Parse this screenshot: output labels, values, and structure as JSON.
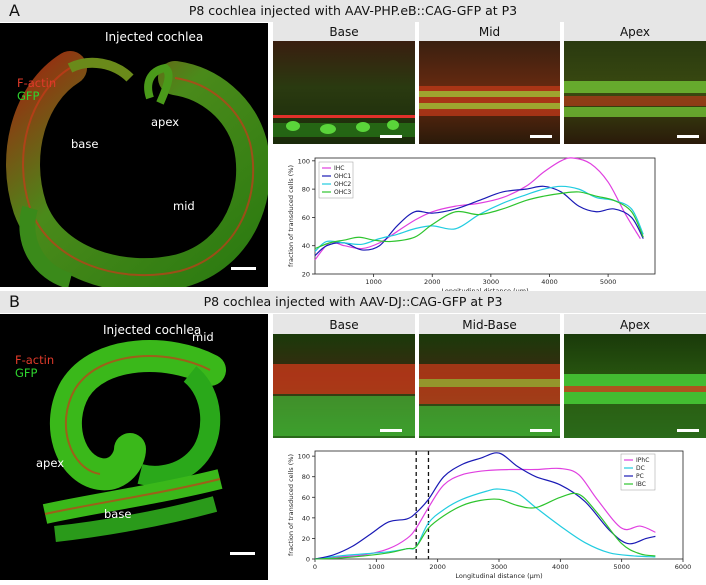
{
  "panel_a": {
    "letter": "A",
    "title": "P8 cochlea injected with AAV-PHP.eB::CAG-GFP at P3",
    "micrograph": {
      "heading": "Injected cochlea",
      "legend_red": "F-actin",
      "legend_green": "GFP",
      "labels": [
        "apex",
        "base",
        "mid"
      ]
    },
    "tiles": [
      "Base",
      "Mid",
      "Apex"
    ]
  },
  "panel_b": {
    "letter": "B",
    "title": "P8 cochlea injected with AAV-DJ::CAG-GFP at P3",
    "micrograph": {
      "heading": "Injected cochlea",
      "legend_red": "F-actin",
      "legend_green": "GFP",
      "labels": [
        "mid",
        "apex",
        "base"
      ]
    },
    "tiles": [
      "Base",
      "Mid-Base",
      "Apex"
    ]
  },
  "colors": {
    "magenta": "#e040e0",
    "blue": "#1a1ab5",
    "cyan": "#22cce0",
    "green": "#2ec42e"
  },
  "chart_data": [
    {
      "type": "line",
      "xlabel": "Longitudinal distance (µm)",
      "ylabel": "fraction of transduced cells (%)",
      "xlim": [
        0,
        5800
      ],
      "ylim": [
        20,
        102
      ],
      "xticks": [
        1000,
        2000,
        3000,
        4000,
        5000
      ],
      "yticks": [
        20,
        40,
        60,
        80,
        100
      ],
      "legend_position": "top-left",
      "series": [
        {
          "name": "IHC",
          "color": "#e040e0",
          "x": [
            0,
            250,
            500,
            800,
            1100,
            1400,
            1700,
            2000,
            2400,
            2800,
            3200,
            3600,
            3900,
            4200,
            4400,
            4700,
            5000,
            5300,
            5550
          ],
          "y": [
            30,
            42,
            40,
            38,
            42,
            50,
            58,
            64,
            68,
            70,
            74,
            82,
            92,
            100,
            102,
            98,
            85,
            62,
            45
          ]
        },
        {
          "name": "OHC1",
          "color": "#1a1ab5",
          "x": [
            0,
            200,
            500,
            800,
            1100,
            1400,
            1700,
            2000,
            2400,
            2800,
            3200,
            3600,
            3900,
            4200,
            4500,
            4800,
            5100,
            5400,
            5600
          ],
          "y": [
            33,
            40,
            42,
            37,
            40,
            54,
            64,
            63,
            66,
            72,
            78,
            80,
            82,
            78,
            68,
            64,
            66,
            60,
            45
          ]
        },
        {
          "name": "OHC2",
          "color": "#22cce0",
          "x": [
            0,
            200,
            500,
            800,
            1100,
            1400,
            1700,
            2000,
            2400,
            2800,
            3200,
            3600,
            3900,
            4200,
            4500,
            4800,
            5100,
            5400,
            5600
          ],
          "y": [
            36,
            43,
            42,
            41,
            45,
            48,
            52,
            54,
            52,
            62,
            70,
            76,
            80,
            82,
            80,
            74,
            72,
            66,
            48
          ]
        },
        {
          "name": "OHC3",
          "color": "#2ec42e",
          "x": [
            0,
            250,
            500,
            750,
            1000,
            1300,
            1700,
            2000,
            2400,
            2800,
            3200,
            3600,
            3900,
            4200,
            4500,
            4800,
            5100,
            5400,
            5600
          ],
          "y": [
            38,
            42,
            44,
            46,
            44,
            43,
            46,
            55,
            64,
            62,
            66,
            72,
            75,
            77,
            78,
            75,
            72,
            64,
            46
          ]
        }
      ]
    },
    {
      "type": "line",
      "xlabel": "Longitudinal distance (µm)",
      "ylabel": "fraction of transduced cells (%)",
      "xlim": [
        0,
        6000
      ],
      "ylim": [
        0,
        105
      ],
      "xticks": [
        0,
        1000,
        2000,
        3000,
        4000,
        5000,
        6000
      ],
      "yticks": [
        0,
        20,
        40,
        60,
        80,
        100
      ],
      "legend_position": "top-right",
      "dashed_vlines": [
        1650,
        1850
      ],
      "series": [
        {
          "name": "IPhC",
          "color": "#e040e0",
          "x": [
            0,
            400,
            800,
            1200,
            1500,
            1650,
            1850,
            2100,
            2400,
            2800,
            3200,
            3600,
            4000,
            4300,
            4600,
            5000,
            5300,
            5550
          ],
          "y": [
            0,
            2,
            4,
            10,
            20,
            30,
            50,
            72,
            82,
            86,
            87,
            87,
            88,
            82,
            58,
            30,
            32,
            26
          ]
        },
        {
          "name": "DC",
          "color": "#22cce0",
          "x": [
            0,
            400,
            800,
            1200,
            1500,
            1650,
            1850,
            2100,
            2400,
            2800,
            3000,
            3300,
            3600,
            4000,
            4400,
            4800,
            5200,
            5550
          ],
          "y": [
            0,
            3,
            5,
            7,
            10,
            12,
            35,
            48,
            58,
            66,
            68,
            64,
            50,
            32,
            16,
            6,
            3,
            2
          ]
        },
        {
          "name": "PC",
          "color": "#1a1ab5",
          "x": [
            0,
            300,
            600,
            900,
            1200,
            1500,
            1650,
            1850,
            2100,
            2400,
            2700,
            3000,
            3300,
            3600,
            4000,
            4400,
            4800,
            5100,
            5400,
            5550
          ],
          "y": [
            0,
            4,
            12,
            24,
            36,
            39,
            45,
            58,
            80,
            92,
            98,
            103,
            90,
            80,
            72,
            56,
            28,
            15,
            20,
            22
          ]
        },
        {
          "name": "IBC",
          "color": "#2ec42e",
          "x": [
            0,
            400,
            800,
            1200,
            1500,
            1650,
            1850,
            2100,
            2400,
            2700,
            3000,
            3300,
            3600,
            4000,
            4300,
            4600,
            5000,
            5300,
            5550
          ],
          "y": [
            0,
            1,
            3,
            6,
            10,
            12,
            30,
            42,
            52,
            57,
            58,
            52,
            50,
            60,
            63,
            45,
            15,
            5,
            3
          ]
        }
      ]
    }
  ]
}
